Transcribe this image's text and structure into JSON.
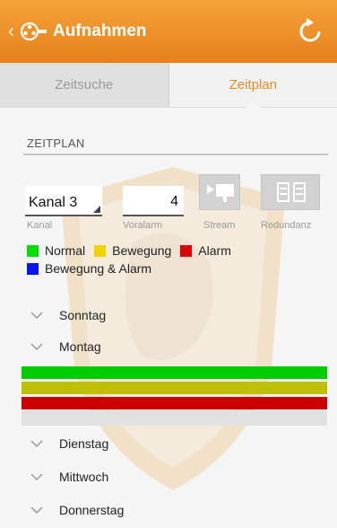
{
  "header": {
    "title": "Aufnahmen"
  },
  "tabs": [
    {
      "label": "Zeitsuche"
    },
    {
      "label": "Zeitplan"
    }
  ],
  "section": {
    "title": "ZEITPLAN"
  },
  "fields": {
    "kanal": {
      "value": "Kanal 3",
      "label": "Kanal"
    },
    "voralarm": {
      "value": "4",
      "label": "Voralarm"
    },
    "stream_label": "Stream",
    "redundanz_label": "Redundanz"
  },
  "legend": [
    {
      "label": "Normal",
      "color": "#00dd00"
    },
    {
      "label": "Bewegung",
      "color": "#f2d300"
    },
    {
      "label": "Alarm",
      "color": "#dd0000"
    },
    {
      "label": "Bewegung & Alarm",
      "color": "#0a16e8"
    }
  ],
  "days": [
    "Sonntag",
    "Montag",
    "Dienstag",
    "Mittwoch",
    "Donnerstag"
  ],
  "schedule_bars": {
    "montag": [
      {
        "type": "Normal",
        "color": "#00cc00"
      },
      {
        "type": "Bewegung",
        "color": "#c0c000"
      },
      {
        "type": "Alarm",
        "color": "#cc0000"
      }
    ]
  },
  "colors": {
    "accent": "#ef8a1d"
  }
}
